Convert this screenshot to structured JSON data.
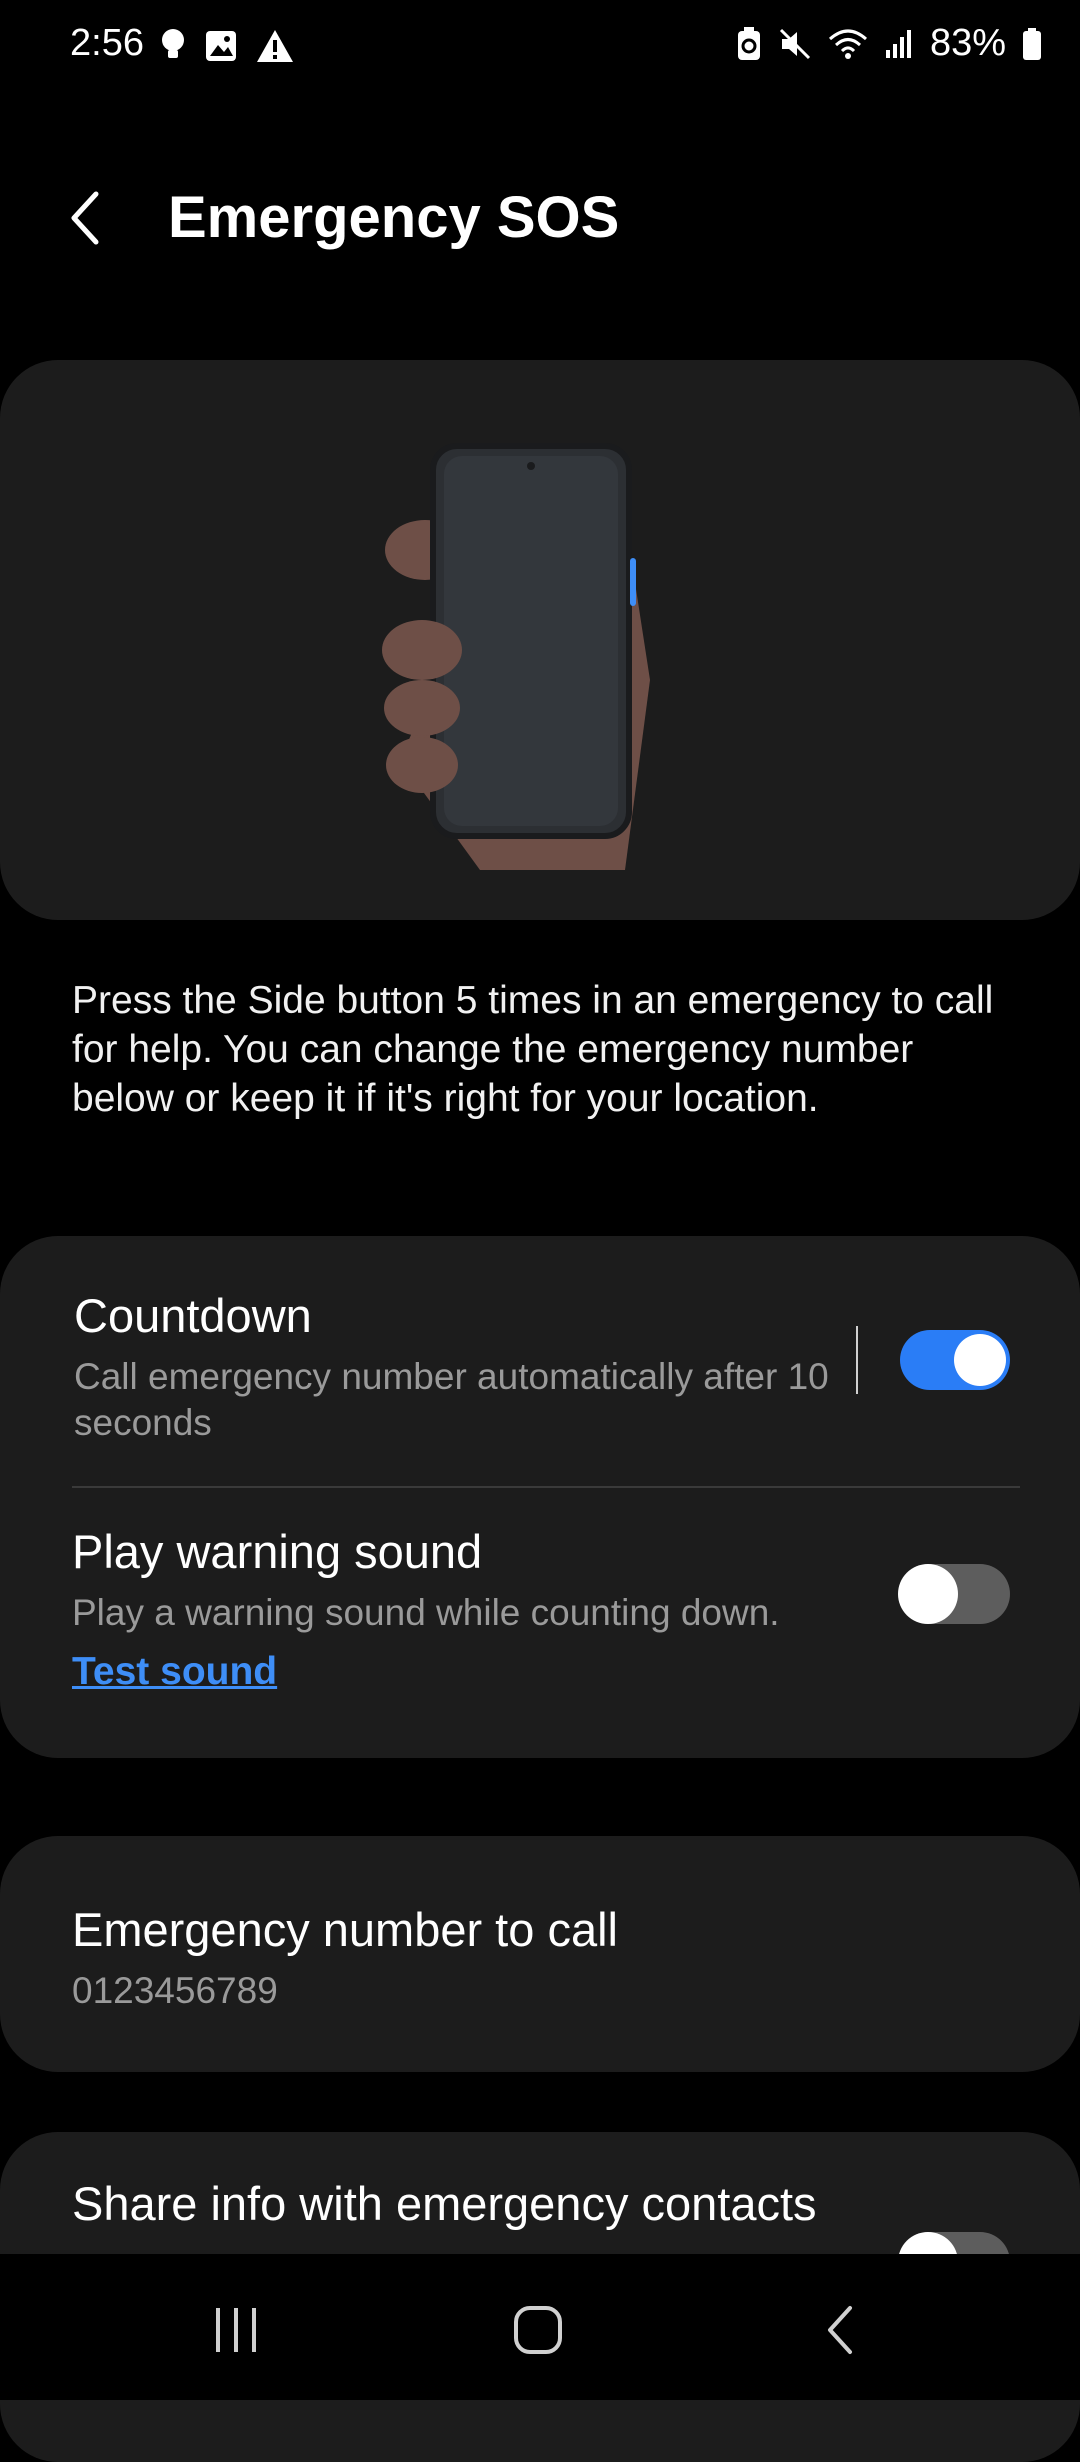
{
  "status": {
    "time": "2:56",
    "battery": "83%",
    "icons": [
      "bulb-icon",
      "image-icon",
      "warning-icon",
      "battery-saver-icon",
      "mute-icon",
      "wifi-icon",
      "signal-icon",
      "battery-icon"
    ]
  },
  "header": {
    "title": "Emergency SOS"
  },
  "description": "Press the Side button 5 times in an emergency to call for help. You can change the emergency number below or keep it if it's right for your location.",
  "settings": {
    "countdown": {
      "title": "Countdown",
      "subtitle": "Call emergency number automatically after 10 seconds",
      "enabled": true
    },
    "warning_sound": {
      "title": "Play warning sound",
      "subtitle": "Play a warning sound while counting down.",
      "link": "Test sound",
      "enabled": false
    }
  },
  "emergency_number": {
    "title": "Emergency number to call",
    "value": "0123456789"
  },
  "share_info": {
    "title": "Share info with emergency contacts",
    "enabled": false
  },
  "colors": {
    "accent": "#2a7df6",
    "link": "#3e8ef7",
    "card": "#1c1c1c",
    "background": "#000000"
  }
}
